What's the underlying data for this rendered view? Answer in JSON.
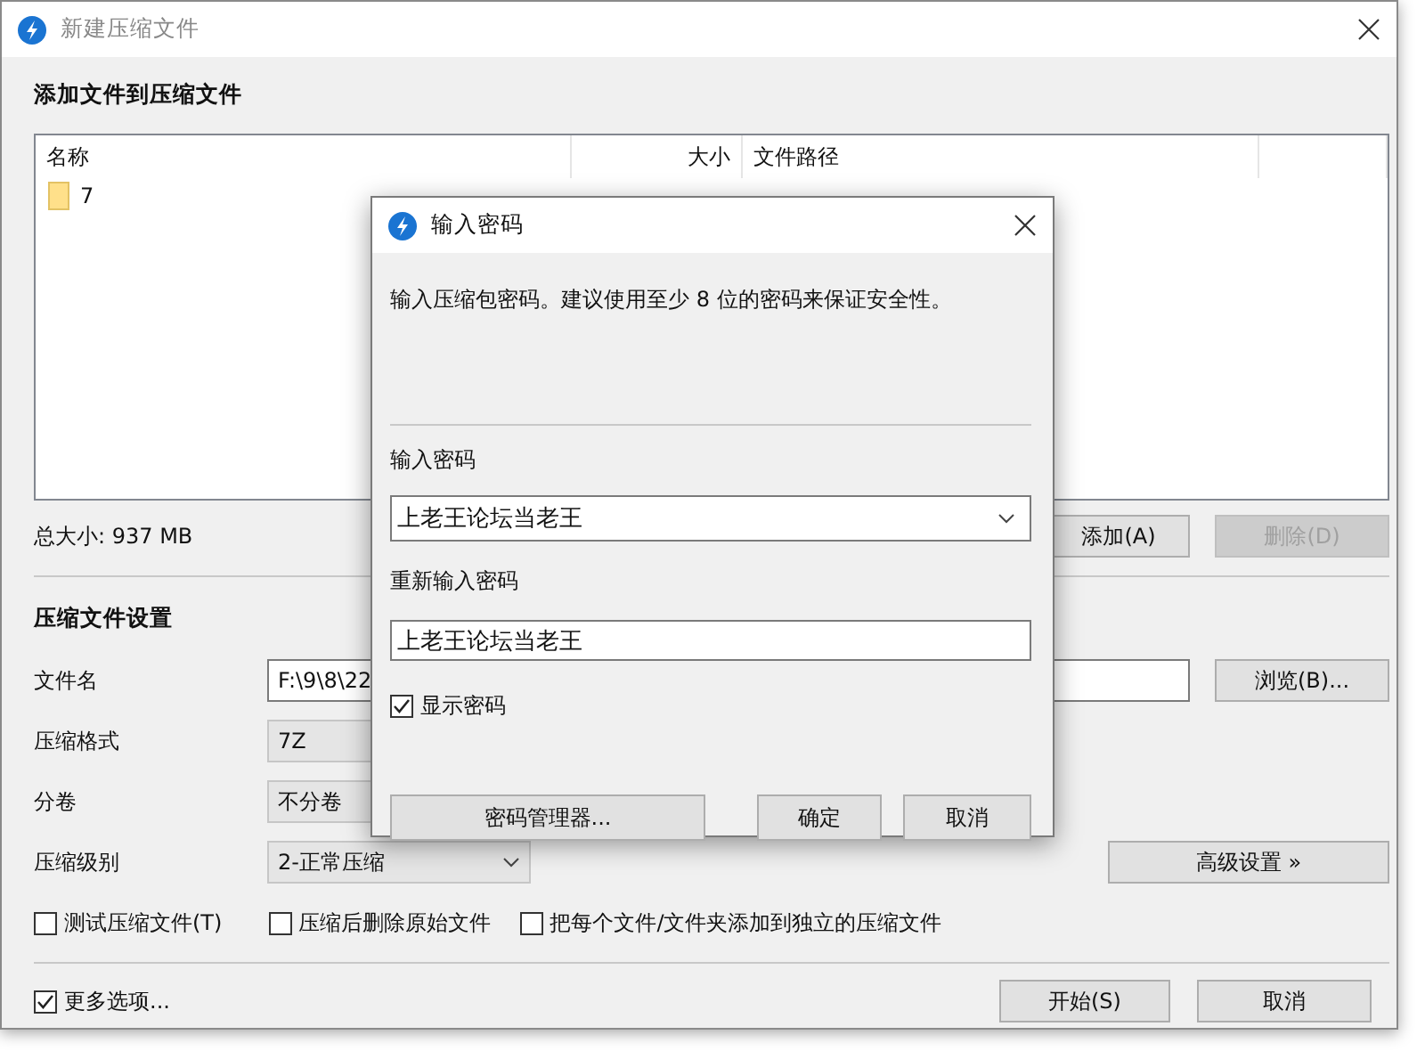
{
  "window": {
    "title": "新建压缩文件"
  },
  "file_section": {
    "heading": "添加文件到压缩文件"
  },
  "file_list": {
    "columns": [
      "名称",
      "大小",
      "文件路径"
    ],
    "rows": [
      {
        "name": "7",
        "kind": "folder"
      }
    ]
  },
  "total_size": "总大小: 937 MB",
  "list_buttons": [
    {
      "label": "添加(A)",
      "disabled": false
    },
    {
      "label": "删除(D)",
      "disabled": true
    }
  ],
  "settings": {
    "heading": "压缩文件设置",
    "fields": [
      {
        "kind": "text",
        "label": "文件名",
        "value": "F:\\9\\8\\22"
      },
      {
        "kind": "box",
        "label": "压缩格式",
        "value": "7Z"
      },
      {
        "kind": "box",
        "label": "分卷",
        "value": "不分卷"
      },
      {
        "kind": "dropdown",
        "label": "压缩级别",
        "value": "2-正常压缩"
      }
    ],
    "browse_button": "浏览(B)...",
    "advanced_button": "高级设置 »"
  },
  "options": [
    {
      "label": "测试压缩文件(T)",
      "checked": false
    },
    {
      "label": "压缩后删除原始文件",
      "checked": false
    },
    {
      "label": "把每个文件/文件夹添加到独立的压缩文件",
      "checked": false
    }
  ],
  "more_options": {
    "label": "更多选项...",
    "checked": true
  },
  "buttons": [
    "开始(S)",
    "取消"
  ],
  "dialog": {
    "title": "输入密码",
    "message": "输入压缩包密码。建议使用至少 8 位的密码来保证安全性。",
    "password_label": "输入密码",
    "password": "上老王论坛当老王",
    "confirm_label": "重新输入密码",
    "confirm": "上老王论坛当老王",
    "show_password": {
      "label": "显示密码",
      "checked": true
    },
    "manager_button": "密码管理器...",
    "ok_button": "确定",
    "cancel_button": "取消"
  }
}
